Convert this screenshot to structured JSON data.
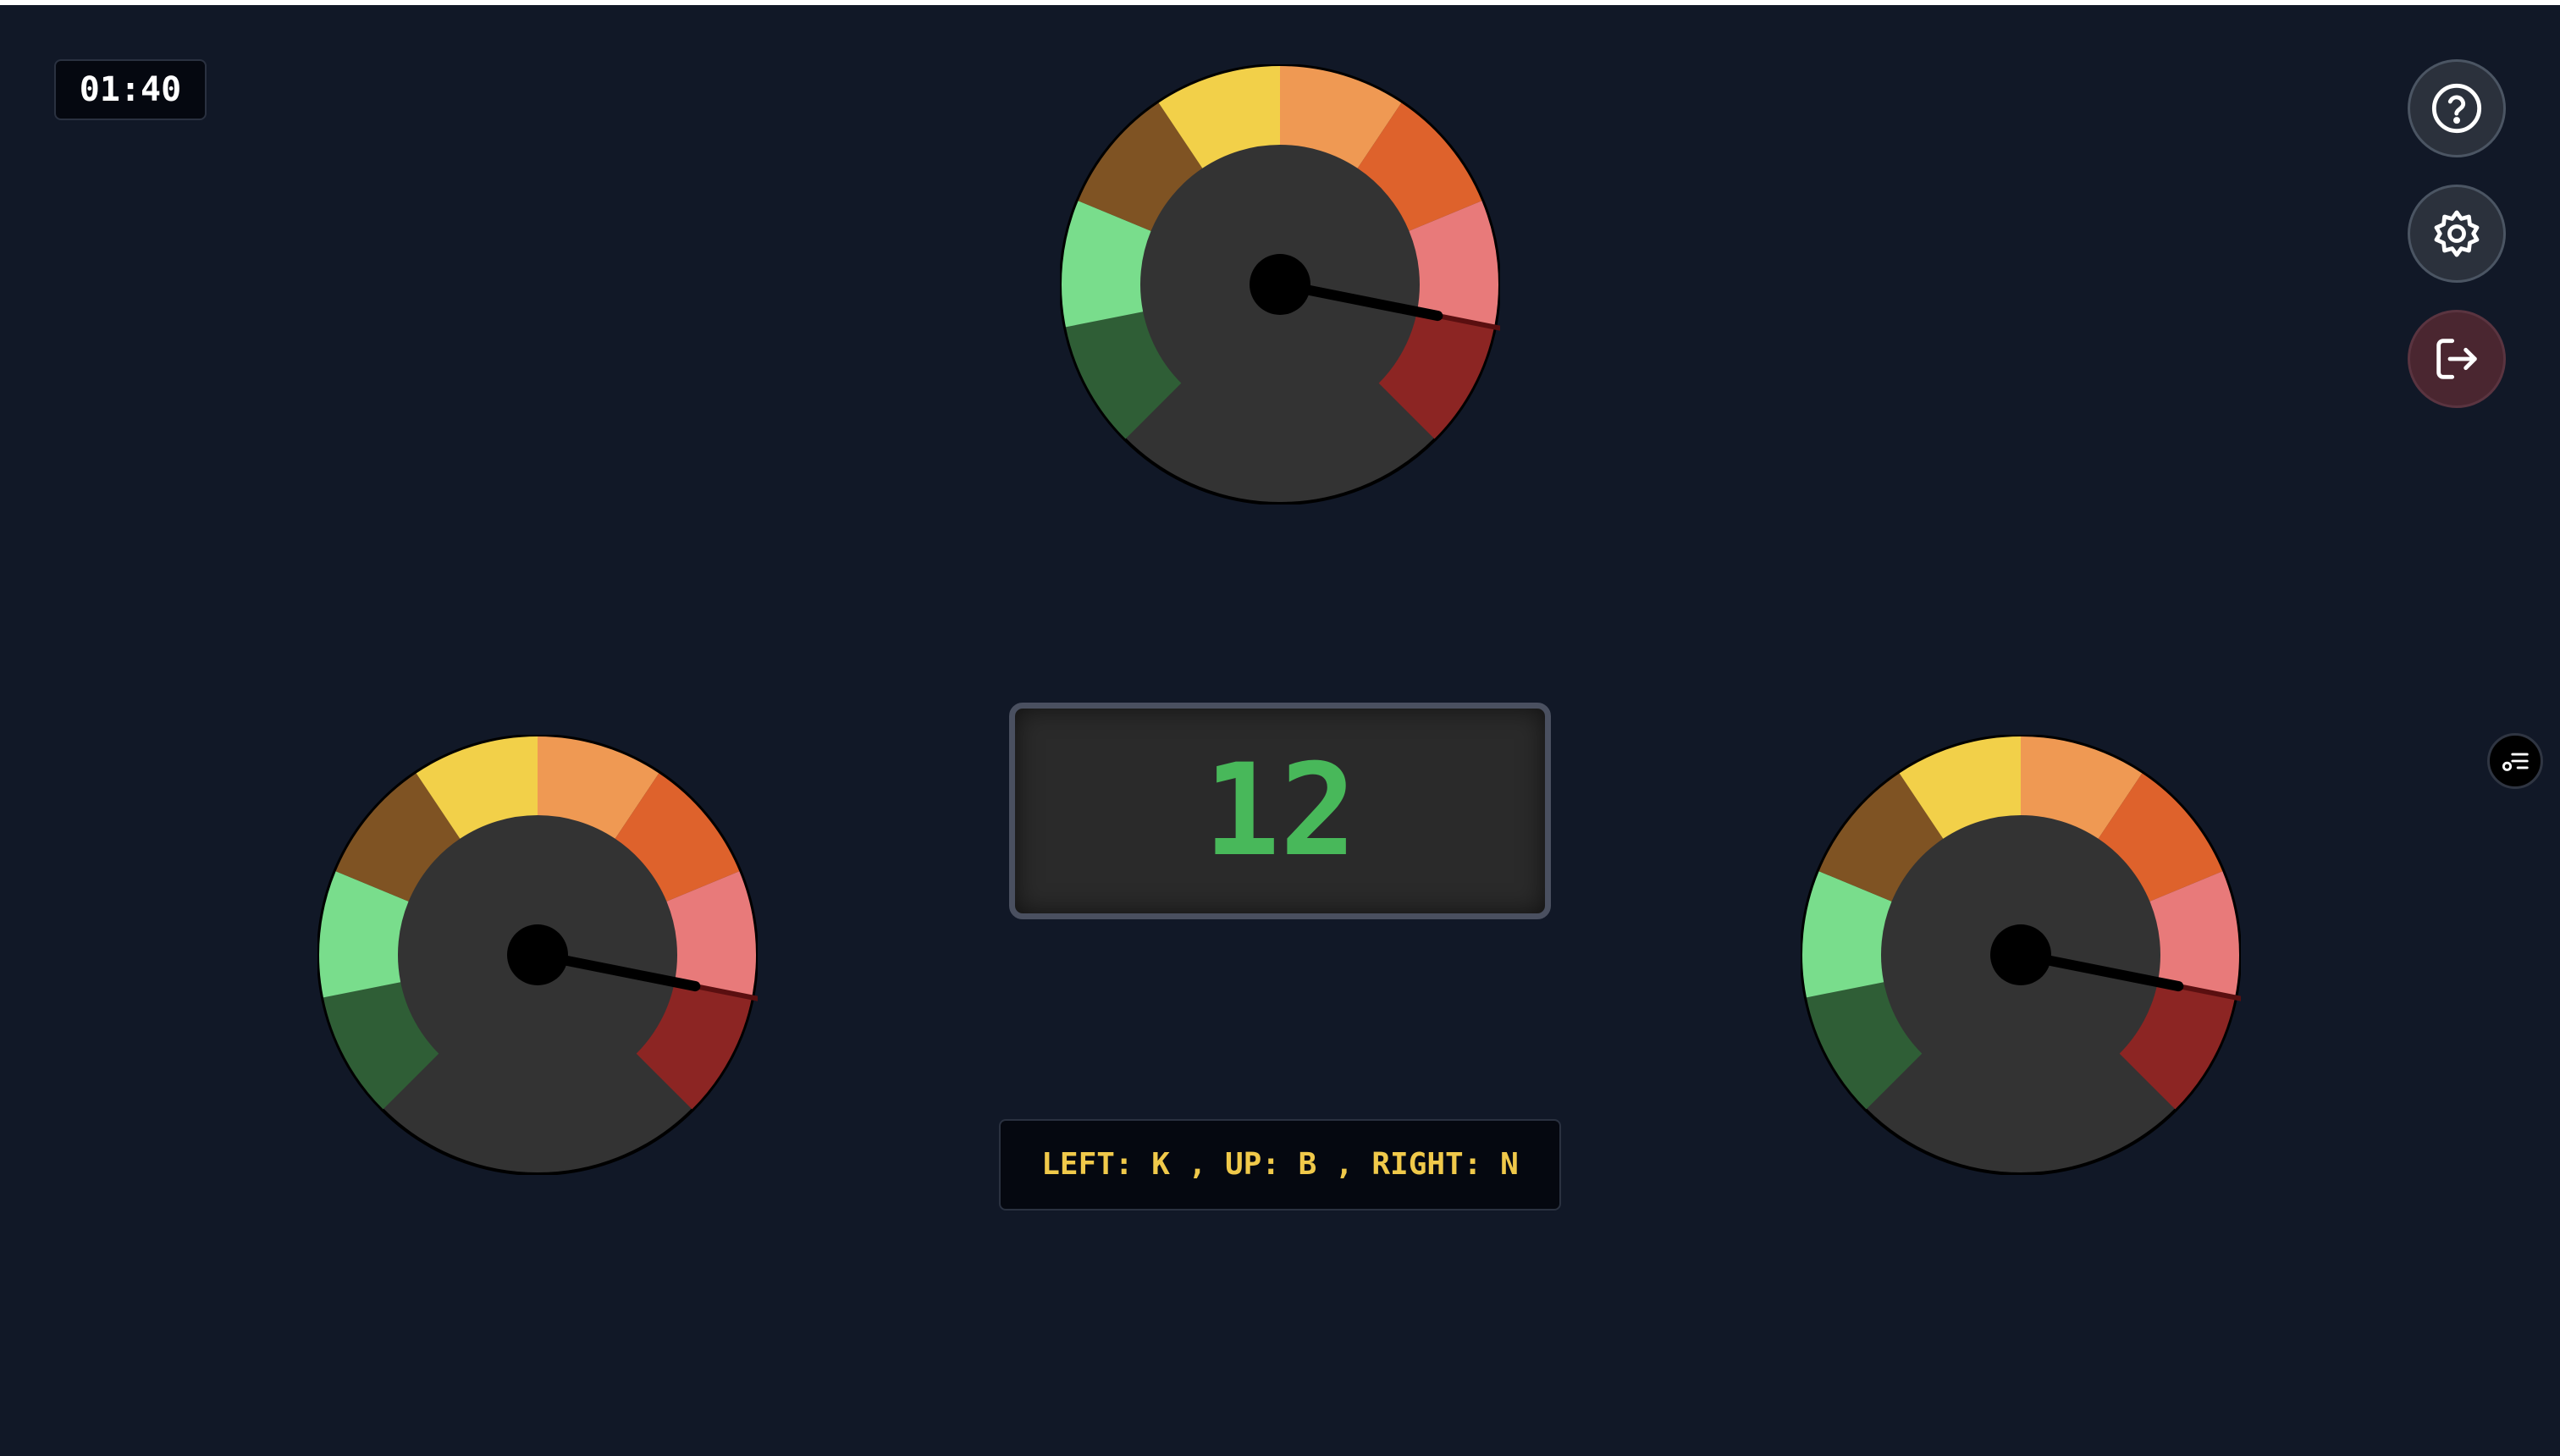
{
  "timer": {
    "text": "01:40"
  },
  "score": {
    "value": "12"
  },
  "controls": {
    "text": "LEFT: K , UP: B , RIGHT: N"
  },
  "gauges": [
    {
      "id": "gauge-up",
      "needle_level": 0.875
    },
    {
      "id": "gauge-left",
      "needle_level": 0.875
    },
    {
      "id": "gauge-right",
      "needle_level": 0.875
    }
  ],
  "gauge_colors": [
    "#2f5e36",
    "#79dd8c",
    "#7f5323",
    "#f2d049",
    "#ef9953",
    "#de622c",
    "#e87a7a",
    "#8c2523"
  ],
  "colors": {
    "background": "#111827",
    "gauge_face": "#333333",
    "needle": "#000000",
    "needle_tip": "#5a0f10",
    "score_text": "#48b85a",
    "controls_text": "#f0c94a"
  },
  "buttons": {
    "help_icon": "question-circle-icon",
    "settings_icon": "gear-icon",
    "exit_icon": "logout-icon",
    "menu_icon": "list-settings-icon"
  }
}
